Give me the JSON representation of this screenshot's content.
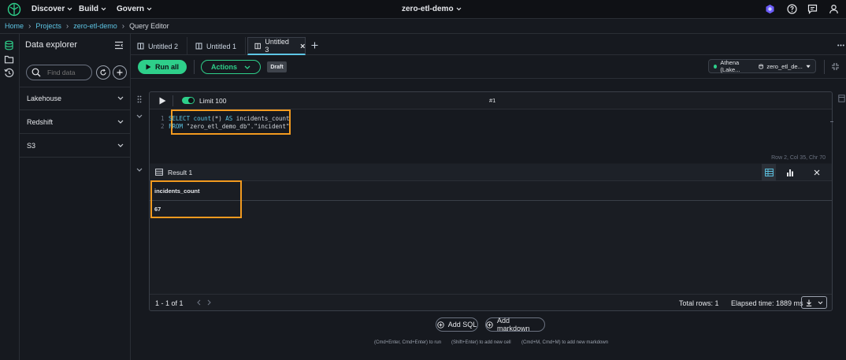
{
  "topbar": {
    "menus": [
      {
        "label": "Discover"
      },
      {
        "label": "Build"
      },
      {
        "label": "Govern"
      }
    ],
    "project": "zero-etl-demo"
  },
  "breadcrumb": [
    "Home",
    "Projects",
    "zero-etl-demo",
    "Query Editor"
  ],
  "explorer": {
    "title": "Data explorer",
    "search_placeholder": "Find data",
    "sections": [
      {
        "label": "Lakehouse"
      },
      {
        "label": "Redshift"
      },
      {
        "label": "S3"
      }
    ]
  },
  "tabs": [
    {
      "label": "Untitled 2",
      "active": false
    },
    {
      "label": "Untitled 1",
      "active": false
    },
    {
      "label": "Untitled 3",
      "active": true
    }
  ],
  "toolbar": {
    "run_all": "Run all",
    "actions": "Actions",
    "draft": "Draft",
    "connection": "Athena (Lake...",
    "database": "zero_etl_de...",
    "connection_status_color": "#2ecf8a"
  },
  "cell": {
    "limit_label": "Limit 100",
    "limit_enabled": true,
    "cell_number": "#1",
    "code_lines": [
      {
        "num": "1",
        "tokens": [
          [
            "kw",
            "SELECT"
          ],
          [
            "t",
            " "
          ],
          [
            "kw",
            "count"
          ],
          [
            "t",
            "(*) "
          ],
          [
            "kw",
            "AS"
          ],
          [
            "t",
            " incidents_count"
          ]
        ]
      },
      {
        "num": "2",
        "tokens": [
          [
            "kw",
            "FROM"
          ],
          [
            "t",
            " \"zero_etl_demo_db\".\"incident\""
          ]
        ]
      }
    ],
    "cursor_status": "Row 2,  Col 35,  Chr 70"
  },
  "result": {
    "title": "Result 1",
    "column": "incidents_count",
    "value": "67",
    "pagination": "1 - 1 of 1",
    "total_rows": "Total rows: 1",
    "elapsed": "Elapsed time: 1889 ms"
  },
  "add_buttons": {
    "add_sql": "Add SQL",
    "add_markdown": "Add markdown"
  },
  "hints": {
    "run": "(Cmd+Enter, Cmd+Enter) to run",
    "add_cell": "(Shift+Enter) to add new cell",
    "add_markdown": "(Cmd+M, Cmd+M) to add new markdown"
  },
  "colors": {
    "accent": "#2ecf8a",
    "link": "#5ec6e5",
    "highlight": "#f29a1f"
  }
}
